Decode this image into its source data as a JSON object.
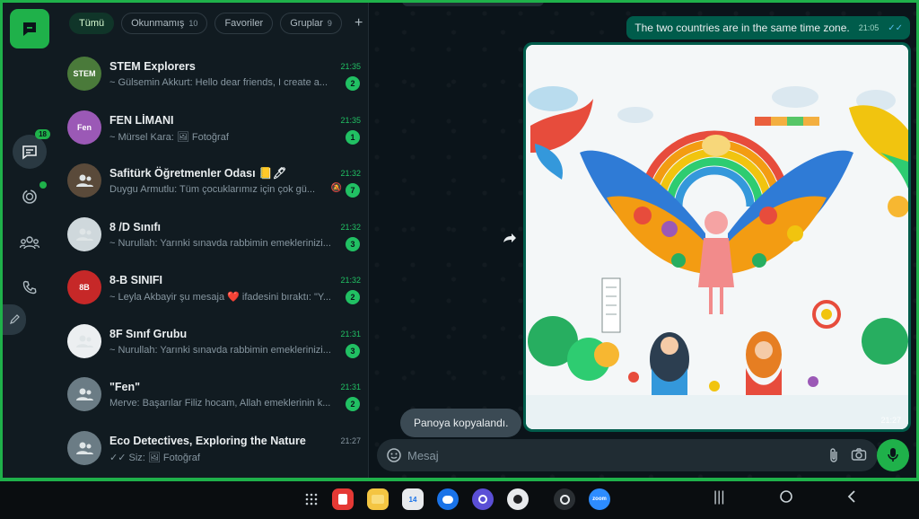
{
  "rail": {
    "chats_badge": "18"
  },
  "filters": [
    {
      "label": "Tümü",
      "count": ""
    },
    {
      "label": "Okunmamış",
      "count": "10"
    },
    {
      "label": "Favoriler",
      "count": ""
    },
    {
      "label": "Gruplar",
      "count": "9"
    }
  ],
  "chats": [
    {
      "name": "STEM Explorers",
      "time": "21:35",
      "preview": "~ Gülsemin Akkurt: Hello dear friends, I create a...",
      "unread": "2",
      "avatar_text": "STEM",
      "avatar_color": "#4a7a3a"
    },
    {
      "name": "FEN LİMANI",
      "time": "21:35",
      "preview": "~ Mürsel Kara: 🖼 Fotoğraf",
      "unread": "1",
      "avatar_text": "Fen",
      "avatar_color": "#9b59b6"
    },
    {
      "name": "Safitürk Öğretmenler Odası 📒🖊",
      "time": "21:32",
      "preview": "Duygu Armutlu: Tüm çocuklarımız için çok gü...",
      "unread": "7",
      "avatar_text": "",
      "avatar_color": "#5a4a3a"
    },
    {
      "name": "8 /D Sınıfı",
      "time": "21:32",
      "preview": "~ Nurullah: Yarınki sınavda rabbimin emeklerinizi...",
      "unread": "3",
      "avatar_text": "",
      "avatar_color": "#cfd8dc"
    },
    {
      "name": "8-B SINIFI",
      "time": "21:32",
      "preview": "~ Leyla Akbayir şu mesaja ❤️ ifadesini bıraktı: \"Y...",
      "unread": "2",
      "avatar_text": "8B",
      "avatar_color": "#c62828"
    },
    {
      "name": "8F Sınıf Grubu",
      "time": "21:31",
      "preview": "~ Nurullah: Yarınki sınavda rabbimin emeklerinizi...",
      "unread": "3",
      "avatar_text": "",
      "avatar_color": "#eceff1"
    },
    {
      "name": "\"Fen\"",
      "time": "21:31",
      "preview": "Merve: Başarılar Filiz hocam, Allah emeklerinin k...",
      "unread": "2",
      "avatar_text": "",
      "avatar_color": "#6b7c85"
    },
    {
      "name": "Eco Detectives,  Exploring the Nature",
      "time": "21:27",
      "preview": "✓✓ Siz: 🖼 Fotoğraf",
      "unread": "",
      "avatar_text": "",
      "avatar_color": "#6b7c85"
    }
  ],
  "conversation": {
    "prev_bubble": "...",
    "out_message": "The two countries are in the same time zone.",
    "out_time": "21:05",
    "image_time": "21:27",
    "toast": "Panoya kopyalandı.",
    "composer_placeholder": "Mesaj"
  },
  "taskbar": {
    "calendar_day": "14",
    "zoom_label": "zoom"
  },
  "colors": {
    "accent": "#1fb14a",
    "outgoing_bubble": "#005c4b",
    "panel": "#111b21",
    "unread": "#21c063"
  }
}
